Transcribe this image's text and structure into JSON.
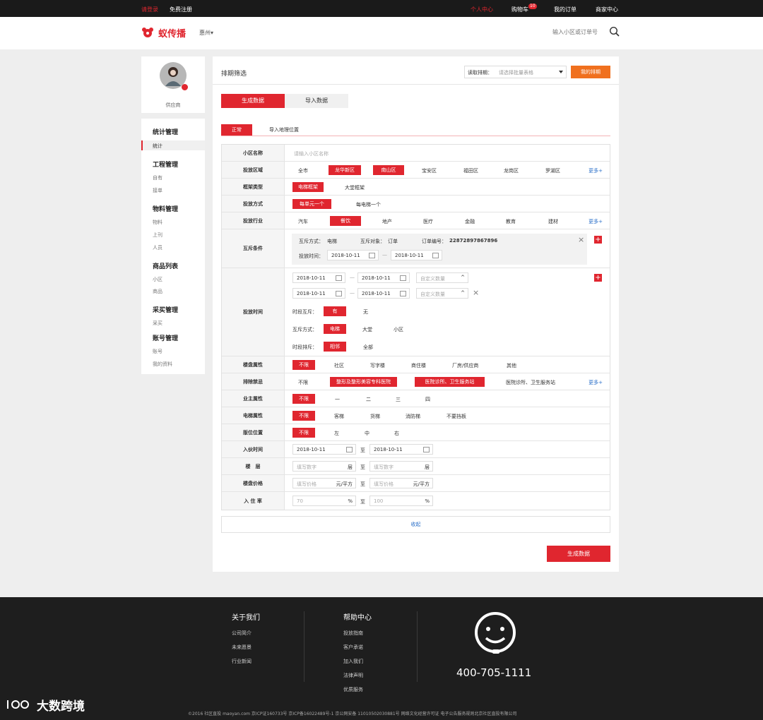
{
  "topbar": {
    "login": "请登录",
    "register": "免费注册",
    "user_center": "个人中心",
    "cart": "购物车",
    "cart_count": "10",
    "orders": "我的订单",
    "merchant": "商家中心"
  },
  "header": {
    "brand": "蚁传播",
    "city": "惠州",
    "search_placeholder": "输入小区或订单号"
  },
  "profile": {
    "name": "供应商"
  },
  "sidebar": {
    "groups": [
      {
        "title": "统计管理",
        "items": [
          "统计"
        ]
      },
      {
        "title": "工程管理",
        "items": [
          "自有",
          "接单"
        ]
      },
      {
        "title": "物料管理",
        "items": [
          "物料",
          "上刊",
          "人员"
        ]
      },
      {
        "title": "商品列表",
        "items": [
          "小区",
          "商品"
        ]
      },
      {
        "title": "采买管理",
        "items": [
          "采买"
        ]
      },
      {
        "title": "账号管理",
        "items": [
          "账号",
          "我的资料"
        ]
      }
    ]
  },
  "main": {
    "title": "排期筛选",
    "read_label": "读取排期：",
    "read_placeholder": "请选择批量表格",
    "my_schedule": "我的排期",
    "tab_generate": "生成数据",
    "tab_import": "导入数据",
    "sub_normal": "正常",
    "sub_geo": "导入地理位置",
    "more": "更多+",
    "collapse": "收起",
    "generate": "生成数据",
    "form": {
      "community": {
        "label": "小区名称",
        "placeholder": "请输入小区名称"
      },
      "district": {
        "label": "投放区域",
        "options": [
          "全市",
          "龙华新区",
          "南山区",
          "宝安区",
          "福田区",
          "龙岗区",
          "罗湖区"
        ]
      },
      "frame": {
        "label": "框架类型",
        "options": [
          "电梯框架",
          "大堂框架"
        ]
      },
      "method": {
        "label": "投放方式",
        "options": [
          "每单元一个",
          "每电梯一个"
        ]
      },
      "industry": {
        "label": "投放行业",
        "options": [
          "汽车",
          "餐饮",
          "地产",
          "医疗",
          "金融",
          "教育",
          "建材"
        ]
      },
      "exclusion": {
        "label": "互斥条件",
        "mode_label": "互斥方式：",
        "mode_value": "电梯",
        "target_label": "互斥对象：",
        "target_value": "订单",
        "order_label": "订单编号：",
        "order_value": "22872897867896",
        "time_label": "投放时间：",
        "date1": "2018-10-11",
        "date2": "2018-10-11"
      },
      "time": {
        "label": "投放时间",
        "d1": "2018-10-11",
        "d2": "2018-10-11",
        "d3": "2018-10-11",
        "d4": "2018-10-11",
        "custom_placeholder": "自定义数量",
        "slot_mutex": "时段互斥：",
        "slot_opts": [
          "有",
          "无"
        ],
        "mutex_mode": "互斥方式：",
        "mode_opts": [
          "电梯",
          "大堂",
          "小区"
        ],
        "slot_exclude": "时段排斥：",
        "excl_opts": [
          "相邻",
          "全部"
        ]
      },
      "property": {
        "label": "楼盘属性",
        "options": [
          "不限",
          "社区",
          "写字楼",
          "商住楼",
          "厂房/供应商",
          "其他"
        ]
      },
      "ban": {
        "label": "排除禁忌",
        "options": [
          "不限",
          "整形及整形美容专科医院",
          "医院诊所、卫生服务站",
          "医院诊所、卫生服务站"
        ]
      },
      "owner": {
        "label": "业主属性",
        "options": [
          "不限",
          "一",
          "二",
          "三",
          "四"
        ]
      },
      "elevator": {
        "label": "电梯属性",
        "options": [
          "不限",
          "客梯",
          "货梯",
          "消防梯",
          "不要挡板"
        ]
      },
      "position": {
        "label": "版位位置",
        "options": [
          "不限",
          "左",
          "中",
          "右"
        ]
      },
      "checkin": {
        "label": "入伙时间",
        "from": "2018-10-11",
        "to_sep": "至",
        "to": "2018-10-11"
      },
      "floor": {
        "label": "楼　层",
        "placeholder": "填写数字",
        "unit": "层",
        "to_sep": "至"
      },
      "price": {
        "label": "楼盘价格",
        "placeholder": "填写价格",
        "unit": "元/平方",
        "to_sep": "至"
      },
      "occupancy": {
        "label": "入 住 率",
        "from": "70",
        "to": "100",
        "unit": "%",
        "to_sep": "至"
      }
    }
  },
  "footer": {
    "about_title": "关于我们",
    "about_links": [
      "公司简介",
      "未来愿景",
      "行业新闻"
    ],
    "help_title": "帮助中心",
    "help_links": [
      "投放指南",
      "客户承诺",
      "加入我们",
      "法律声明",
      "优质服务"
    ],
    "hotline": "400-705-1111",
    "copyright": "©2016 社区直投 maoyan.com 京ICP证160733号 京ICP备16022489号-1 京公网安备 11010502030881号 网络文化经营许可证 电子公告服务规则北京社区直投有限公司",
    "watermark": "大数跨境"
  },
  "colors": {
    "accent": "#e0262f",
    "orange": "#f0701e",
    "footer_bg": "#1e1e1e",
    "link": "#2a6fc9"
  }
}
